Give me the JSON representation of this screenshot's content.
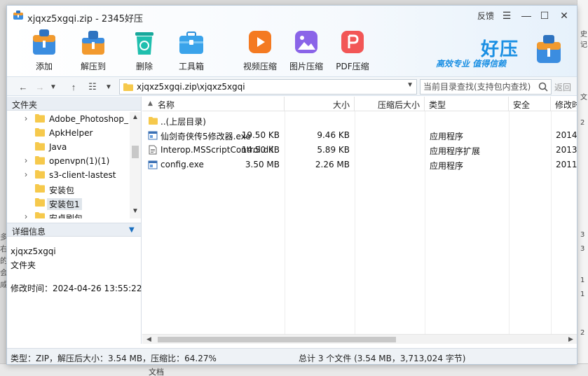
{
  "window": {
    "title": "xjqxz5xgqi.zip - 2345好压",
    "feedback": "反馈"
  },
  "toolbar": {
    "add": "添加",
    "extract": "解压到",
    "delete": "删除",
    "toolbox": "工具箱",
    "video": "视频压缩",
    "image": "图片压缩",
    "pdf": "PDF压缩"
  },
  "brand": {
    "name": "好压",
    "slogan": "高效专业  值得信赖"
  },
  "addressbar": {
    "path": "xjqxz5xgqi.zip\\xjqxz5xgqi",
    "search_placeholder": "当前目录查找(支持包内查找)",
    "return": "返回"
  },
  "left": {
    "folder_header": "文件夹",
    "tree": [
      {
        "name": "Adobe_Photoshop_",
        "expandable": true
      },
      {
        "name": "ApkHelper",
        "expandable": false
      },
      {
        "name": "Java",
        "expandable": false
      },
      {
        "name": "openvpn(1)(1)",
        "expandable": true
      },
      {
        "name": "s3-client-lastest",
        "expandable": true
      },
      {
        "name": "安装包",
        "expandable": false
      },
      {
        "name": "安装包1",
        "expandable": false,
        "selected": true
      },
      {
        "name": "安卓刷包",
        "expandable": true
      }
    ],
    "detail_header": "详细信息",
    "detail": {
      "name": "xjqxz5xgqi",
      "type": "文件夹",
      "modified": "修改时间：2024-04-26 13:55:22"
    }
  },
  "columns": {
    "name": "名称",
    "size": "大小",
    "packed": "压缩后大小",
    "type": "类型",
    "security": "安全",
    "modified": "修改时"
  },
  "files": [
    {
      "icon": "folder-icon",
      "name": "..(上层目录)",
      "size": "",
      "packed": "",
      "type": "",
      "modified": ""
    },
    {
      "icon": "exe-file-icon",
      "name": "仙剑奇侠传5修改器.exe",
      "size": "19.50 KB",
      "packed": "9.46 KB",
      "type": "应用程序",
      "modified": "2014-"
    },
    {
      "icon": "dll-file-icon",
      "name": "Interop.MSScriptControl.dll",
      "size": "14.50 KB",
      "packed": "5.89 KB",
      "type": "应用程序扩展",
      "modified": "2013-"
    },
    {
      "icon": "exe-file-icon",
      "name": "config.exe",
      "size": "3.50 MB",
      "packed": "2.26 MB",
      "type": "应用程序",
      "modified": "2011-"
    }
  ],
  "status": {
    "left": "类型：ZIP，解压后大小：3.54 MB，压缩比：64.27%",
    "right": "总计 3 个文件 (3.54 MB，3,713,024 字节)"
  },
  "background": {
    "right_frags": [
      "史记",
      "文",
      "2",
      "3",
      "3",
      "1",
      "1",
      "2"
    ],
    "left_frags": [
      "多",
      "右",
      "的",
      "会",
      "咸"
    ],
    "bottom_frag": "文档"
  },
  "colors": {
    "accent": "#1a8fe3",
    "folder": "#f6c94c",
    "header_bg": "#e9eef4"
  }
}
